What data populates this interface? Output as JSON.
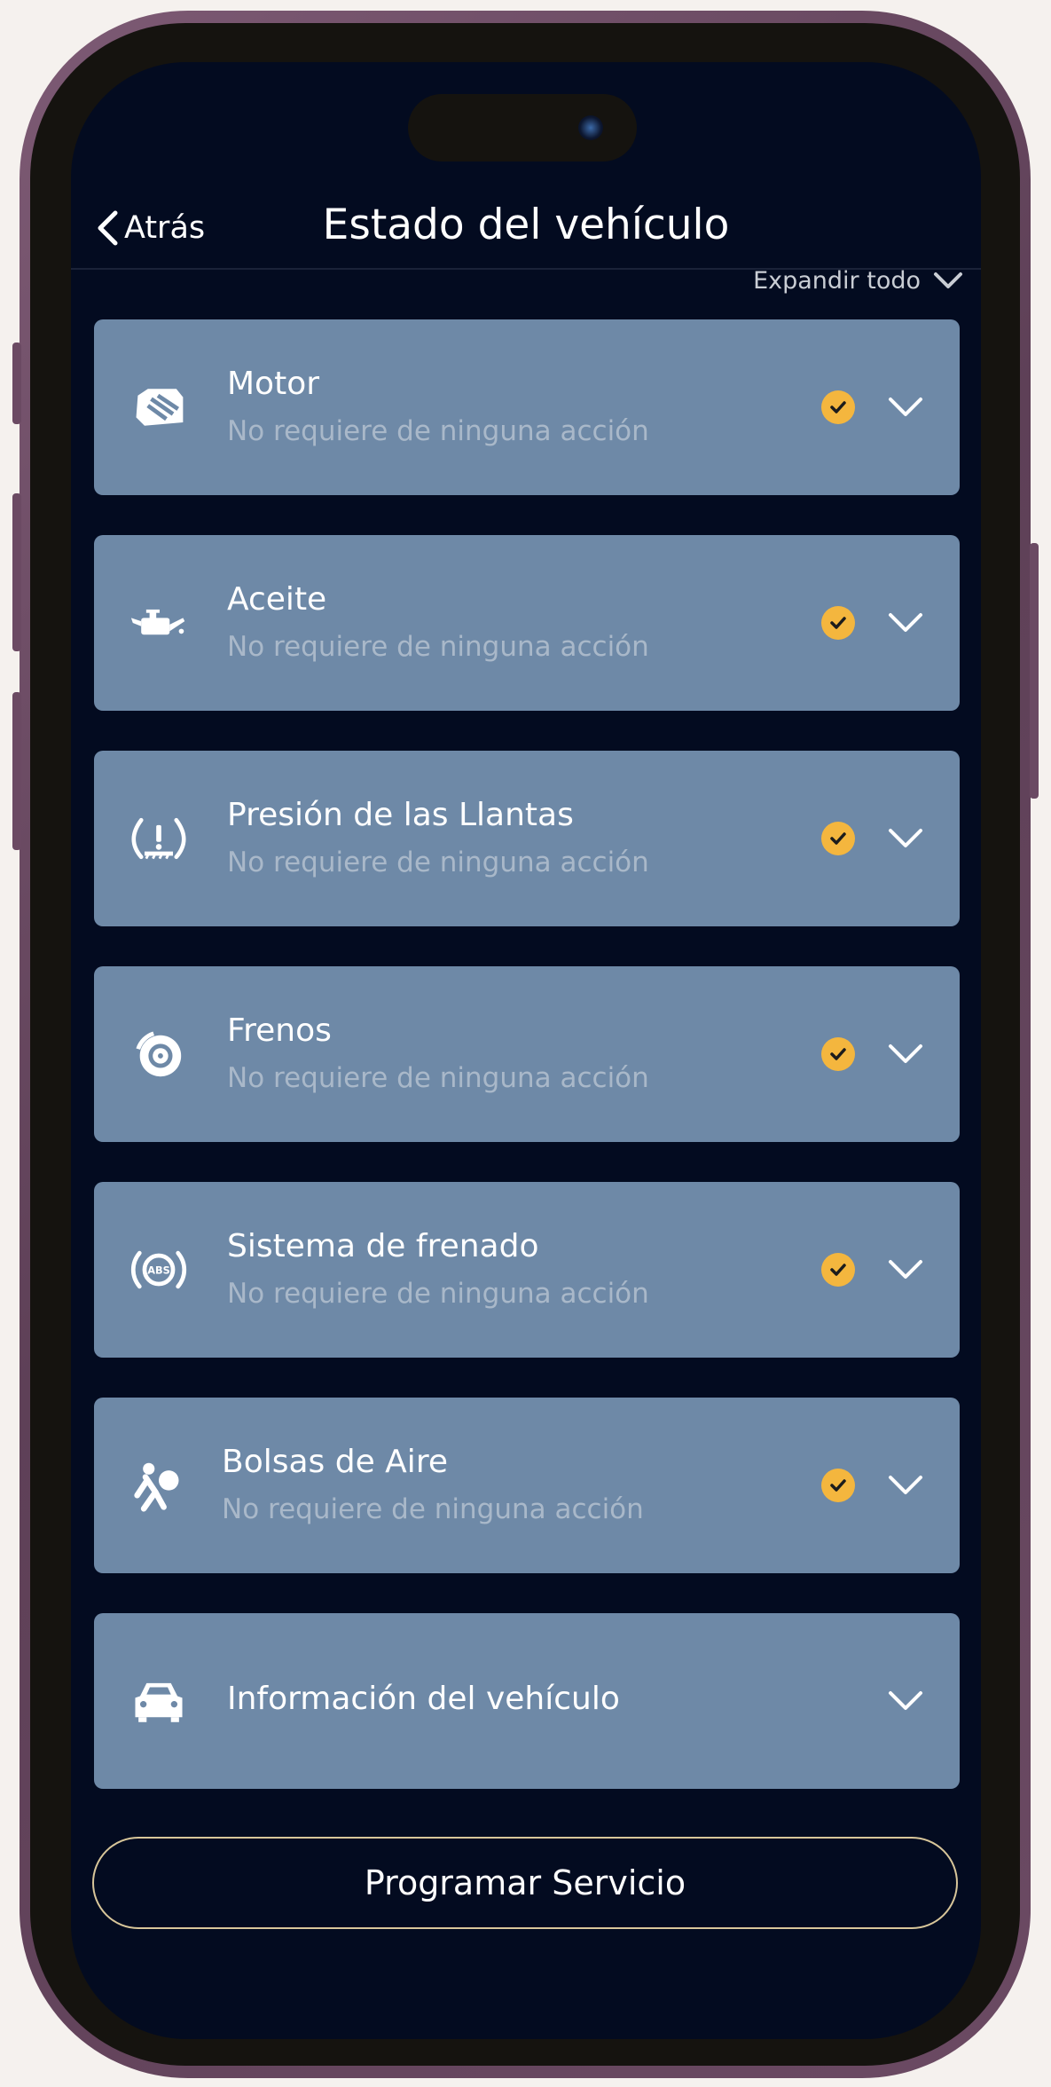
{
  "nav": {
    "back_label": "Atrás",
    "title": "Estado del vehículo"
  },
  "expand_all_label": "Expandir todo",
  "status_items": [
    {
      "title": "Motor",
      "subtitle": "No requiere de ninguna acción",
      "icon": "engine-icon",
      "status": "ok"
    },
    {
      "title": "Aceite",
      "subtitle": "No requiere de ninguna acción",
      "icon": "oil-can-icon",
      "status": "ok"
    },
    {
      "title": "Presión de las Llantas",
      "subtitle": "No requiere de ninguna acción",
      "icon": "tire-pressure-icon",
      "status": "ok"
    },
    {
      "title": "Frenos",
      "subtitle": "No requiere de ninguna acción",
      "icon": "brake-disc-icon",
      "status": "ok"
    },
    {
      "title": "Sistema de frenado",
      "subtitle": "No requiere de ninguna acción",
      "icon": "abs-icon",
      "status": "ok"
    },
    {
      "title": "Bolsas de Aire",
      "subtitle": "No requiere de ninguna acción",
      "icon": "airbag-icon",
      "status": "ok"
    }
  ],
  "vehicle_info": {
    "title": "Información del vehículo",
    "icon": "car-icon"
  },
  "cta_label": "Programar Servicio",
  "colors": {
    "screen_bg": "#030b20",
    "card_bg": "#6e89a7",
    "check": "#f4b63e",
    "cta_border": "#d8c69a"
  }
}
